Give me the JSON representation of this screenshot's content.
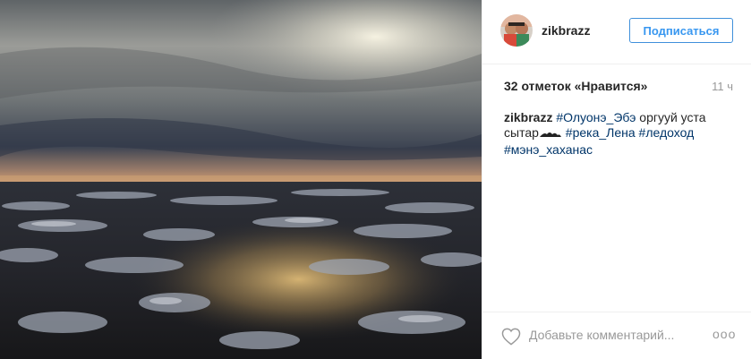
{
  "post": {
    "image_description_icon": "photo-of-river-ice-at-sunset"
  },
  "header": {
    "username": "zikbrazz",
    "follow_label": "Подписаться"
  },
  "stats": {
    "likes_label": "32 отметок «Нравится»",
    "time_ago": "11 ч"
  },
  "caption": {
    "username": "zikbrazz",
    "tag1": "#Олуонэ_Эбэ",
    "text1": " оргууй уста сытар",
    "tag2": "#река_Лена",
    "tag3": "#ледоход",
    "tag4": "#мэнэ_хаханас"
  },
  "footer": {
    "comment_placeholder": "Добавьте комментарий...",
    "more_label": "ooo"
  },
  "colors": {
    "accent": "#3897f0",
    "hashtag": "#003569",
    "muted": "#999999"
  }
}
